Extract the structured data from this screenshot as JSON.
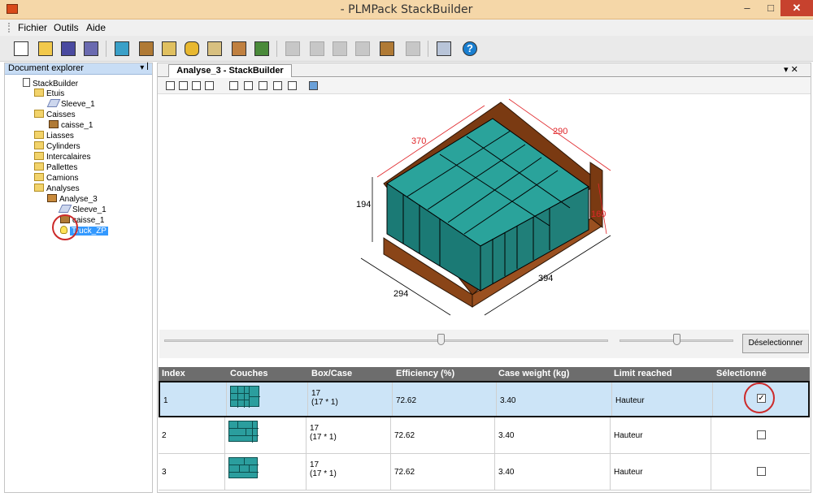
{
  "window": {
    "title": "- PLMPack StackBuilder",
    "minimize": "–",
    "maximize": "□",
    "close": "✕"
  },
  "menu": [
    "Fichier",
    "Outils",
    "Aide"
  ],
  "toolbar_icons": [
    "new-document-icon",
    "open-folder-icon",
    "save-icon",
    "save-all-icon",
    "new-box-icon",
    "new-case-icon",
    "new-bundle-icon",
    "new-cylinder-icon",
    "new-interlayer-icon",
    "new-pallet-icon",
    "new-truck-icon",
    "case-analysis-icon",
    "case-optimization-icon",
    "pallet-analysis-icon",
    "box-pallet-icon",
    "abcd-case-icon",
    "pack-icon",
    "database-icon",
    "help-icon"
  ],
  "explorer": {
    "title": "Document explorer",
    "ctrl": "▾ ꟾ",
    "nodes": [
      {
        "label": "StackBuilder",
        "icon": "document-icon"
      },
      {
        "label": "Etuis",
        "icon": "folder-icon"
      },
      {
        "label": "Sleeve_1",
        "icon": "sleeve-icon"
      },
      {
        "label": "Caisses",
        "icon": "folder-icon"
      },
      {
        "label": "caisse_1",
        "icon": "box-icon"
      },
      {
        "label": "Liasses",
        "icon": "folder-icon"
      },
      {
        "label": "Cylinders",
        "icon": "folder-icon"
      },
      {
        "label": "Intercalaires",
        "icon": "folder-icon"
      },
      {
        "label": "Pallettes",
        "icon": "folder-icon"
      },
      {
        "label": "Camions",
        "icon": "folder-icon"
      },
      {
        "label": "Analyses",
        "icon": "folder-icon"
      },
      {
        "label": "Analyse_3",
        "icon": "analysis-icon"
      },
      {
        "label": "Sleeve_1",
        "icon": "sleeve-icon"
      },
      {
        "label": "caisse_1",
        "icon": "box-icon"
      },
      {
        "label": "Truck_ZP",
        "icon": "lightbulb-icon"
      }
    ]
  },
  "document": {
    "tab": "Analyse_3 - StackBuilder",
    "tab_ctrl": "▾ ✕",
    "view_icons": [
      "view-front-icon",
      "view-left-icon",
      "view-right-icon",
      "view-back-icon",
      "view-top-icon",
      "view-iso-icon",
      "view-side-icon",
      "view-plane-icon",
      "view-plane2-icon",
      "image-icon"
    ],
    "dims": {
      "length": "370",
      "width": "290",
      "height_left": "194",
      "height_right": "160",
      "base_length": "294",
      "base_width": "394"
    },
    "deselect": "Déselectionner",
    "slider1_value": 0.6,
    "slider2_value": 0.3
  },
  "grid": {
    "headers": [
      "Index",
      "Couches",
      "Box/Case",
      "Efficiency (%)",
      "Case weight (kg)",
      "Limit reached",
      "Sélectionné"
    ],
    "rows": [
      {
        "index": "1",
        "count": "17",
        "layout": "(17 * 1)",
        "efficiency": "72.62",
        "weight": "3.40",
        "limit": "Hauteur",
        "checked": "✓"
      },
      {
        "index": "2",
        "count": "17",
        "layout": "(17 * 1)",
        "efficiency": "72.62",
        "weight": "3.40",
        "limit": "Hauteur",
        "checked": ""
      },
      {
        "index": "3",
        "count": "17",
        "layout": "(17 * 1)",
        "efficiency": "72.62",
        "weight": "3.40",
        "limit": "Hauteur",
        "checked": ""
      }
    ]
  }
}
